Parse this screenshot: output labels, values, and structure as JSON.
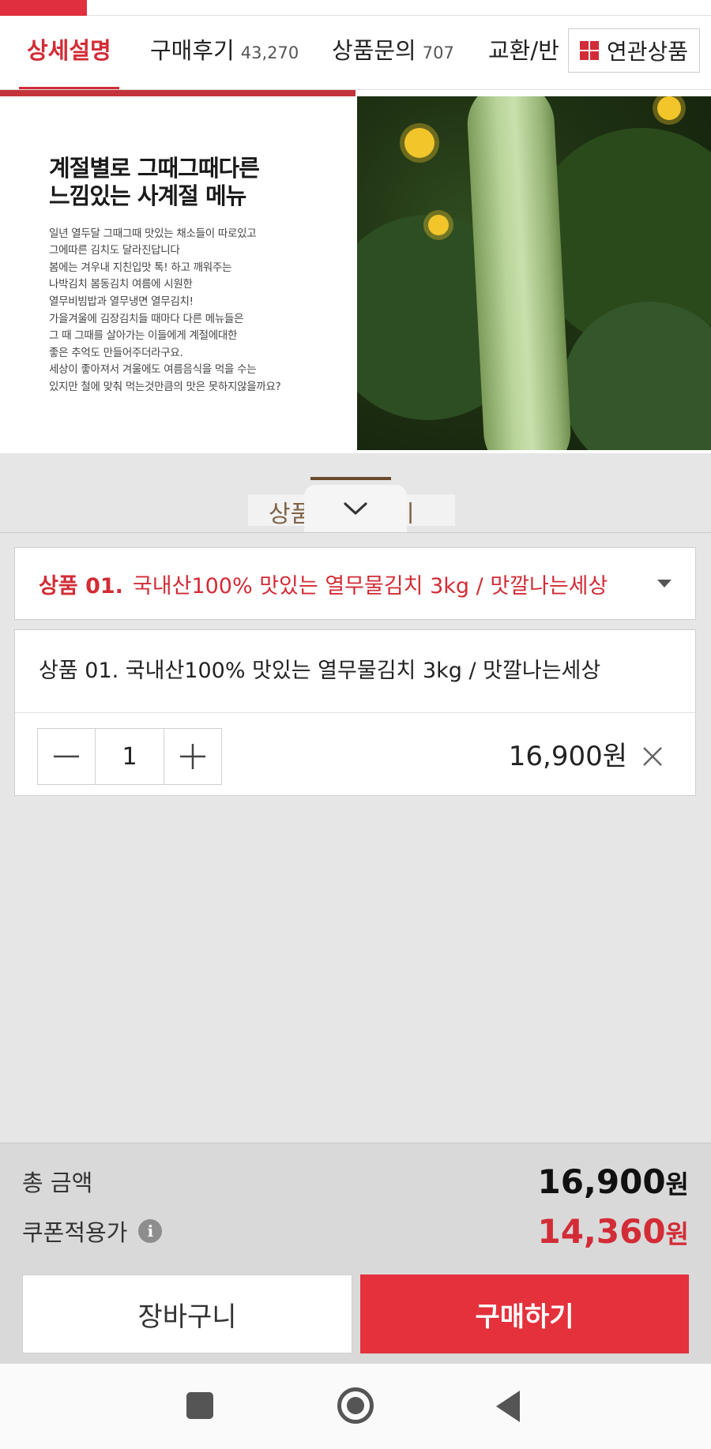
{
  "tabs": {
    "items": [
      {
        "label": "상세설명",
        "count": ""
      },
      {
        "label": "구매후기",
        "count": "43,270"
      },
      {
        "label": "상품문의",
        "count": "707"
      },
      {
        "label": "교환/반",
        "count": ""
      }
    ],
    "related_label": "연관상품"
  },
  "detail": {
    "title": "계절별로 그때그때다른\n느낌있는 사계절 메뉴",
    "body": "일년 열두달 그때그때 맛있는 채소들이 따로있고\n그에따른 김치도 달라진답니다\n봄에는 겨우내 지친입맛 톡! 하고 깨워주는\n나박김치 봄동김치 여름에 시원한\n열무비빔밥과 열무냉면 열무김치!\n가을겨울에 김장김치들 때마다 다른 메뉴들은\n그 때 그때를 살아가는 이들에게 계절에대한\n좋은 추억도 만들어주더라구요.\n세상이 좋아져서 겨울에도 여름음식을 먹을 수는\n있지만 철에 맞춰 먹는것만큼의 맛은 못하지않을까요?",
    "section_ghost_text": "상품 정보 고시"
  },
  "option": {
    "label": "상품 01.",
    "value": "국내산100% 맛있는 열무물김치 3kg / 맛깔나는세상"
  },
  "item": {
    "name": "상품 01. 국내산100% 맛있는 열무물김치 3kg / 맛깔나는세상",
    "quantity": "1",
    "price": "16,900원"
  },
  "summary": {
    "total_label": "총 금액",
    "total_value": "16,900",
    "coupon_label": "쿠폰적용가",
    "coupon_value": "14,360",
    "currency": "원",
    "info_symbol": "i"
  },
  "actions": {
    "cart_label": "장바구니",
    "buy_label": "구매하기"
  },
  "colors": {
    "accent": "#d22c36",
    "buy_button": "#e4313c"
  },
  "icons": [
    "grid-icon",
    "chevron-down-icon",
    "caret-down-icon",
    "minus-icon",
    "plus-icon",
    "close-icon",
    "info-icon",
    "recent-apps-icon",
    "home-icon",
    "back-icon"
  ]
}
